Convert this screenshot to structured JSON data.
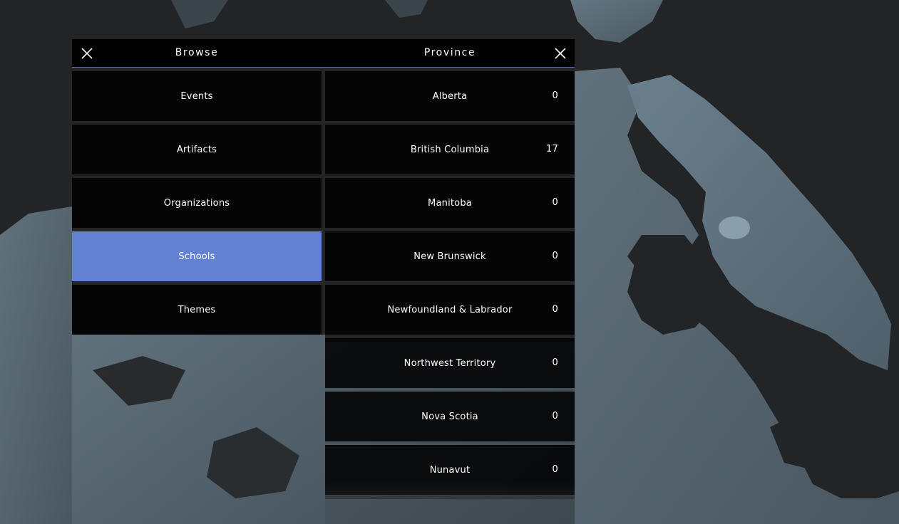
{
  "browse": {
    "title": "Browse",
    "items": [
      {
        "label": "Events"
      },
      {
        "label": "Artifacts"
      },
      {
        "label": "Organizations"
      },
      {
        "label": "Schools"
      },
      {
        "label": "Themes"
      }
    ],
    "selected": "Schools"
  },
  "province": {
    "title": "Province",
    "items": [
      {
        "label": "Alberta",
        "count": "0"
      },
      {
        "label": "British Columbia",
        "count": "17"
      },
      {
        "label": "Manitoba",
        "count": "0"
      },
      {
        "label": "New Brunswick",
        "count": "0"
      },
      {
        "label": "Newfoundland & Labrador",
        "count": "0"
      },
      {
        "label": "Northwest Territory",
        "count": "0"
      },
      {
        "label": "Nova Scotia",
        "count": "0"
      },
      {
        "label": "Nunavut",
        "count": "0"
      }
    ]
  },
  "colors": {
    "background": "#232425",
    "land": "#5e707d",
    "tile": "#000000",
    "accent": "#6281d3",
    "divider": "#5f6f9c"
  },
  "icons": {
    "close_left": "close-icon",
    "close_right": "close-icon"
  }
}
